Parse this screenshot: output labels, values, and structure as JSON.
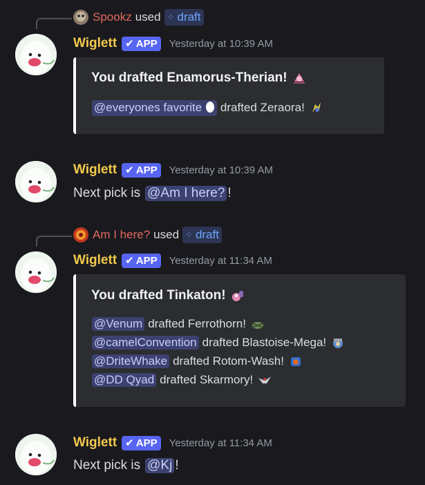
{
  "messages": [
    {
      "reply": {
        "user": "Spookz",
        "verb": "used",
        "command": "draft"
      },
      "username": "Wiglett",
      "badge": "APP",
      "timestamp": "Yesterday at 10:39 AM",
      "embed": {
        "title": "You drafted Enamorus-Therian!",
        "lines": [
          {
            "mention": "@everyones favorite",
            "text": "drafted Zeraora!"
          }
        ]
      }
    },
    {
      "username": "Wiglett",
      "badge": "APP",
      "timestamp": "Yesterday at 10:39 AM",
      "text_prefix": "Next pick is",
      "mention": "@Am I here?",
      "text_suffix": "!"
    },
    {
      "reply": {
        "user": "Am I here?",
        "verb": "used",
        "command": "draft"
      },
      "username": "Wiglett",
      "badge": "APP",
      "timestamp": "Yesterday at 11:34 AM",
      "embed": {
        "title": "You drafted Tinkaton!",
        "lines": [
          {
            "mention": "@Venum",
            "text": "drafted Ferrothorn!"
          },
          {
            "mention": "@camelConvention",
            "text": "drafted Blastoise-Mega!"
          },
          {
            "mention": "@DriteWhake",
            "text": "drafted Rotom-Wash!"
          },
          {
            "mention": "@DD Qyad",
            "text": "drafted Skarmory!"
          }
        ]
      }
    },
    {
      "username": "Wiglett",
      "badge": "APP",
      "timestamp": "Yesterday at 11:34 AM",
      "text_prefix": "Next pick is",
      "mention": "@Kj",
      "text_suffix": "!"
    }
  ],
  "colors": {
    "background": "#1a1a1e",
    "username": "#f2c94c",
    "badge": "#5865f2",
    "mention_bg": "#3c4270",
    "embed_bg": "#2b2d31"
  }
}
